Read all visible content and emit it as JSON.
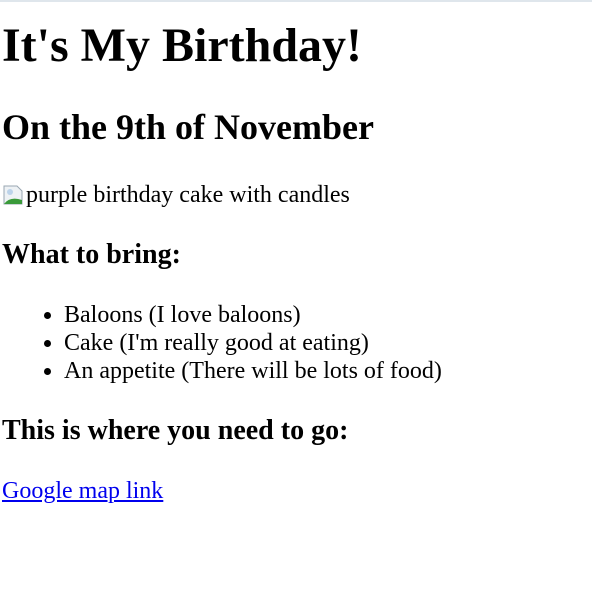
{
  "title": "It's My Birthday!",
  "subtitle": "On the 9th of November",
  "image_alt": "purple birthday cake with candles",
  "bring_heading": "What to bring:",
  "bring_items": [
    "Baloons (I love baloons)",
    "Cake (I'm really good at eating)",
    "An appetite (There will be lots of food)"
  ],
  "location_heading": "This is where you need to go:",
  "map_link": "Google map link"
}
